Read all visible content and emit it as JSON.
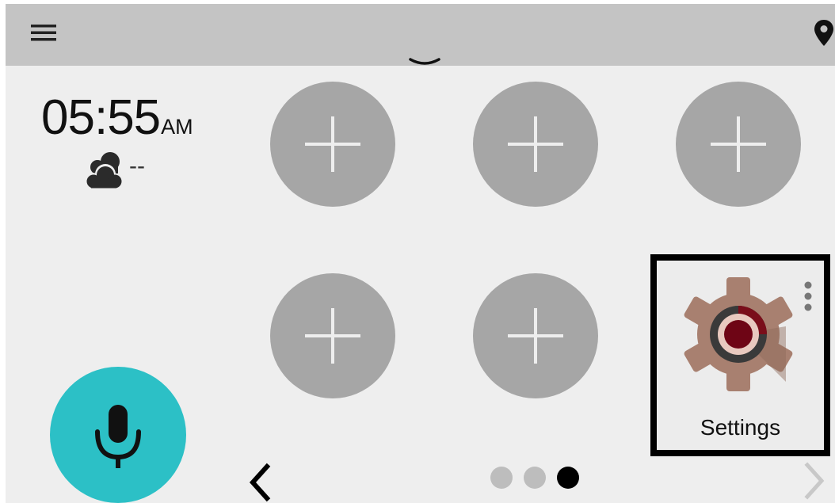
{
  "status": {
    "time": "05:55",
    "ampm": "AM",
    "temperature": "--"
  },
  "icons": {
    "menu": "hamburger-menu-icon",
    "location": "map-pin-icon",
    "handle": "pull-down-handle-icon",
    "weather": "cloudy-icon",
    "add": "plus-icon",
    "settings": "gear-icon",
    "more": "vertical-ellipsis-icon",
    "voice": "microphone-icon",
    "prev": "chevron-left-icon",
    "next": "chevron-right-icon"
  },
  "apps": {
    "settings_label": "Settings"
  },
  "pager": {
    "page_count": 3,
    "active_page": 3
  },
  "colors": {
    "top_bar": "#c4c4c4",
    "background": "#eeeeee",
    "empty_slot": "#a6a6a6",
    "mic_button": "#2cc0c6",
    "dot_active": "#000000",
    "dot_inactive": "#bdbdbd"
  }
}
